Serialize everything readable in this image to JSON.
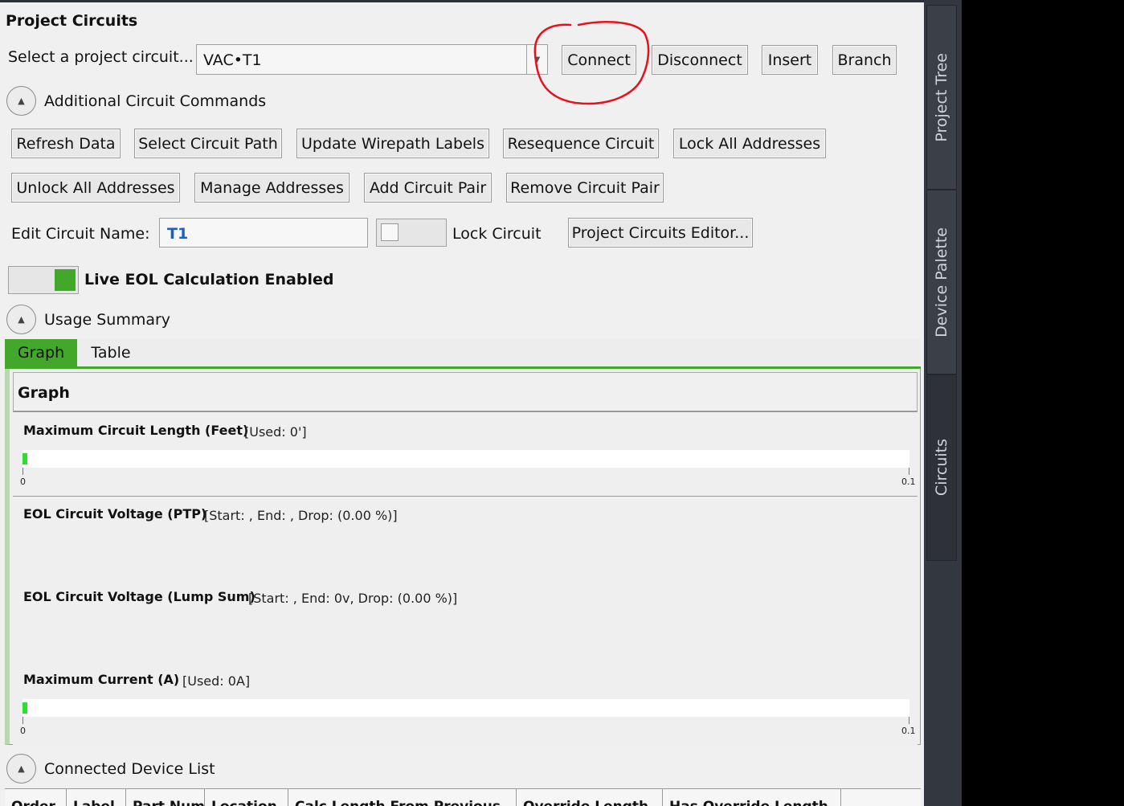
{
  "panel": {
    "title": "Project Circuits",
    "select_label": "Select a project circuit...",
    "selected_circuit": "VAC•T1",
    "buttons": {
      "connect": "Connect",
      "disconnect": "Disconnect",
      "insert": "Insert",
      "branch": "Branch"
    },
    "additional_commands_label": "Additional Circuit Commands",
    "commands": {
      "refresh_data": "Refresh Data",
      "select_circuit_path": "Select Circuit Path",
      "update_wirepath_labels": "Update Wirepath Labels",
      "resequence_circuit": "Resequence Circuit",
      "lock_all_addresses": "Lock All Addresses",
      "unlock_all_addresses": "Unlock All Addresses",
      "manage_addresses": "Manage Addresses",
      "add_circuit_pair": "Add Circuit Pair",
      "remove_circuit_pair": "Remove Circuit Pair"
    },
    "edit_name_label": "Edit Circuit Name:",
    "circuit_name": "T1",
    "lock_circuit_label": "Lock Circuit",
    "lock_circuit_on": false,
    "project_circuits_editor": "Project Circuits Editor...",
    "live_eol_label": "Live EOL Calculation Enabled",
    "live_eol_on": true,
    "usage_summary_label": "Usage Summary",
    "tabs": [
      "Graph",
      "Table"
    ],
    "active_tab": "Graph",
    "graph": {
      "header": "Graph",
      "max_length": {
        "title": "Maximum Circuit Length (Feet)",
        "info": "[Used: 0']",
        "used_fraction": 0.005,
        "min_label": "0",
        "max_label": "0.1"
      },
      "eol_ptp": {
        "title": "EOL Circuit Voltage (PTP)",
        "info": "[Start: , End: , Drop:  (0.00 %)]"
      },
      "eol_lump": {
        "title": "EOL Circuit Voltage (Lump Sum)",
        "info": "[Start: , End: 0v, Drop:  (0.00 %)]"
      },
      "max_current": {
        "title": "Maximum Current (A)",
        "info": "[Used: 0A]",
        "used_fraction": 0.005,
        "min_label": "0",
        "max_label": "0.1"
      }
    },
    "connected_devices_label": "Connected Device List",
    "device_columns": [
      "Order",
      "Label",
      "Part Number",
      "Location",
      "Calc Length From Previous",
      "Override Length",
      "Has Override Length"
    ]
  },
  "side_tabs": [
    "Project Tree",
    "Device Palette",
    "Circuits"
  ],
  "active_side_tab": "Circuits",
  "colors": {
    "accent_green": "#41a82a",
    "bar_green": "#2de02d",
    "annotation_red": "#e8101a",
    "rail": "#33373f"
  }
}
